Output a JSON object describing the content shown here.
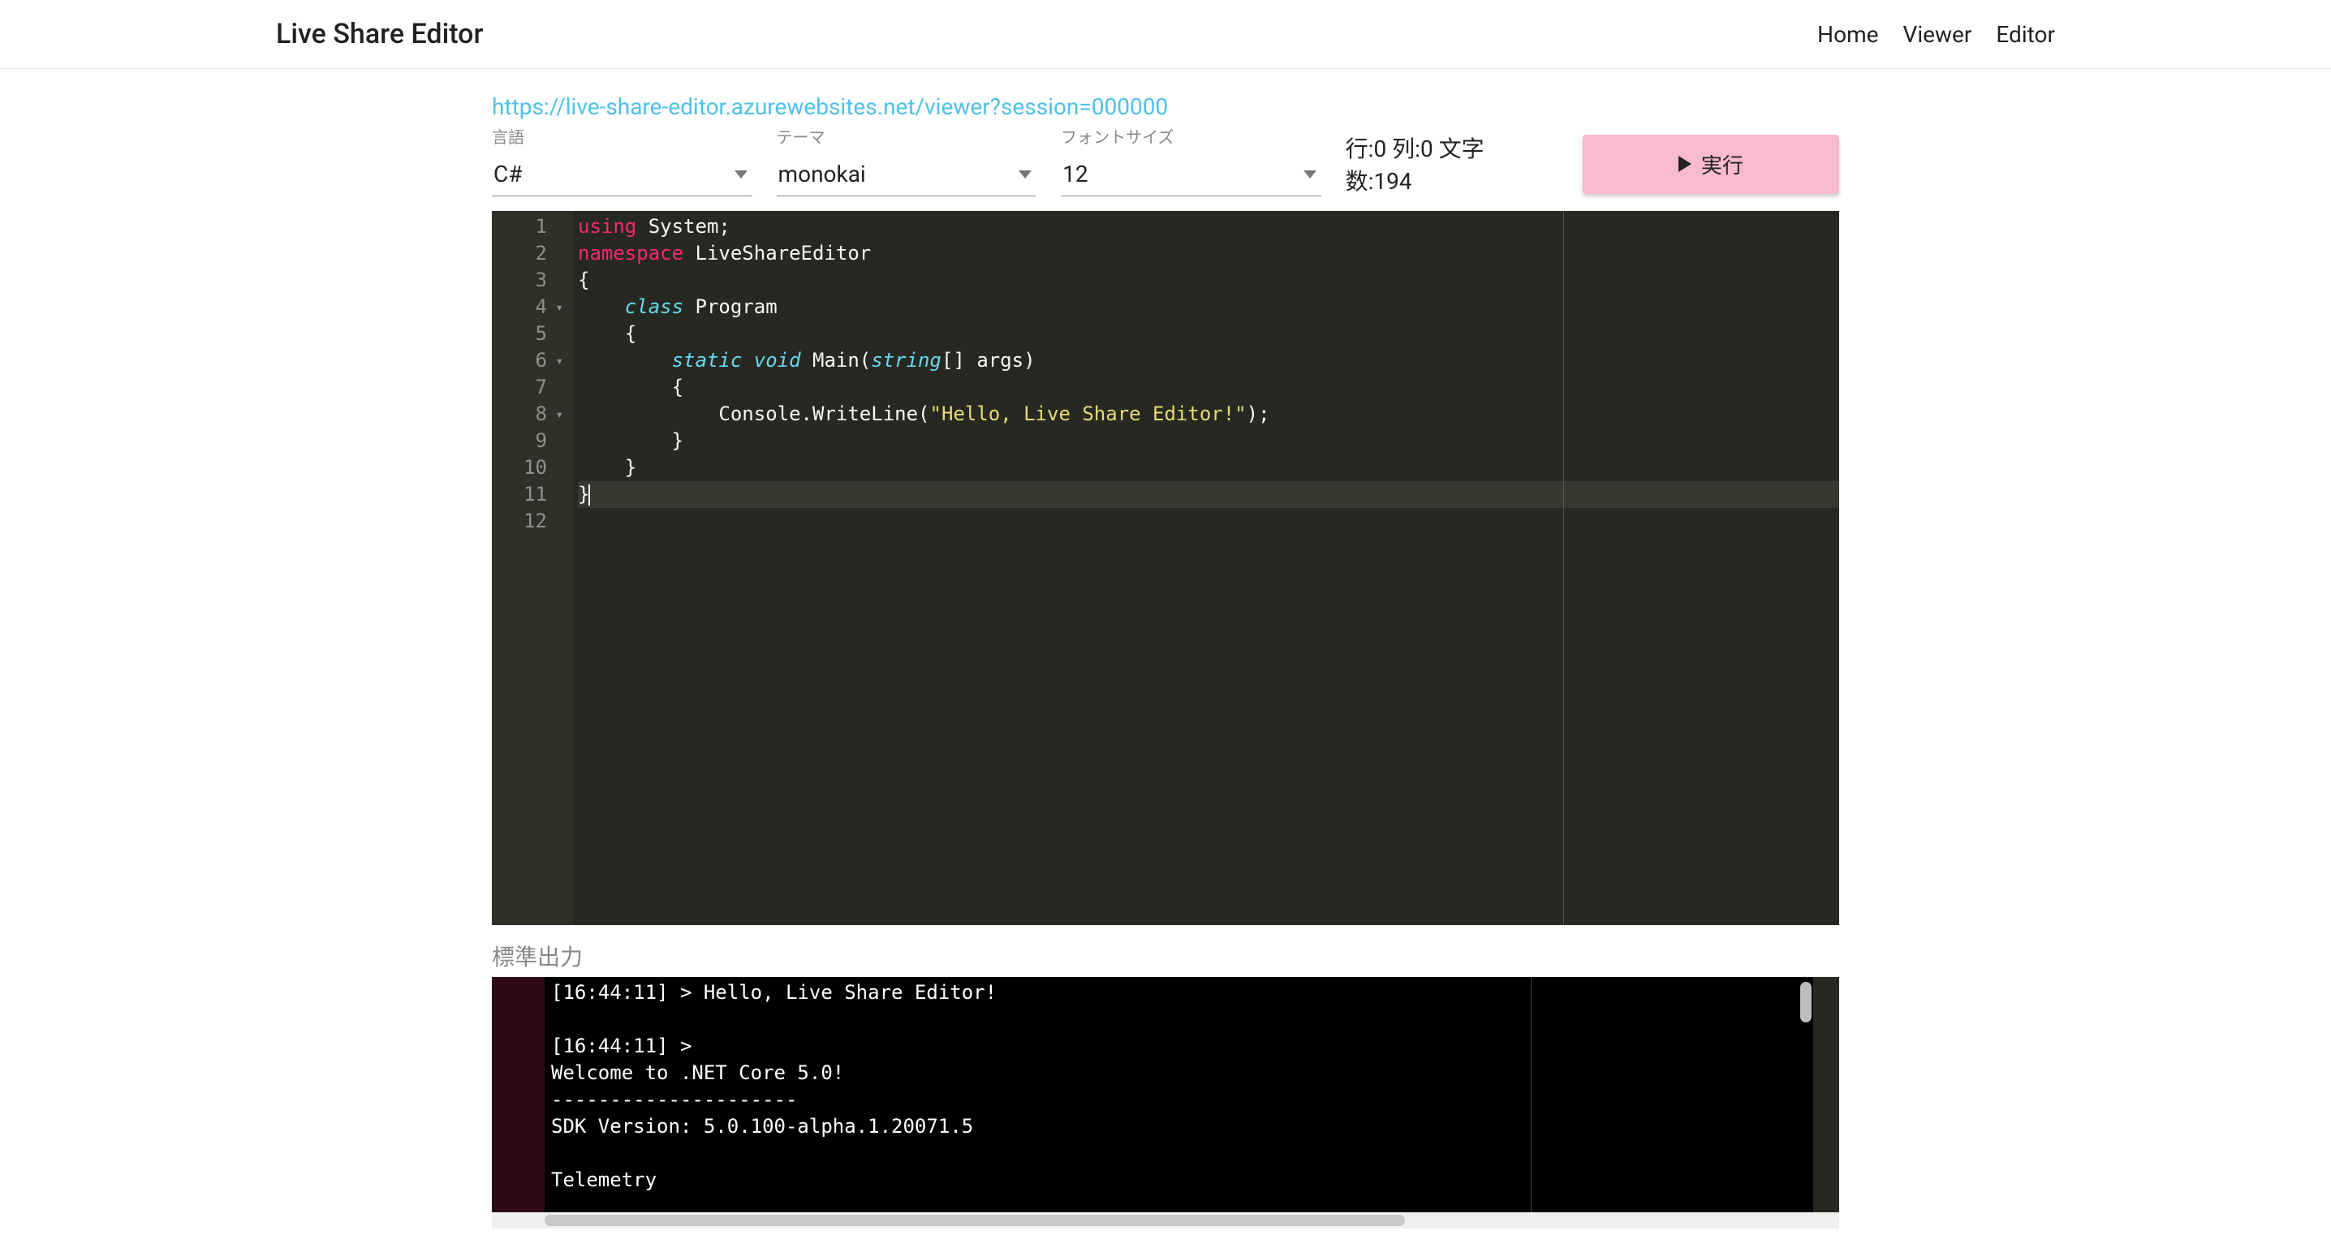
{
  "header": {
    "brand": "Live Share Editor",
    "nav": {
      "home": "Home",
      "viewer": "Viewer",
      "editor": "Editor"
    }
  },
  "share_url": "https://live-share-editor.azurewebsites.net/viewer?session=000000",
  "selects": {
    "language": {
      "label": "言語",
      "value": "C#"
    },
    "theme": {
      "label": "テーマ",
      "value": "monokai"
    },
    "fontsize": {
      "label": "フォントサイズ",
      "value": "12"
    }
  },
  "status": {
    "line_label": "行:",
    "line": "0",
    "col_label": "列:",
    "col": "0",
    "chars_label": "文字数:",
    "chars": "194"
  },
  "run_label": "実行",
  "code": {
    "tokens": [
      [
        {
          "t": "using",
          "c": "kw-pink"
        },
        {
          "t": " ",
          "c": "punct"
        },
        {
          "t": "System",
          "c": "ident"
        },
        {
          "t": ";",
          "c": "punct"
        }
      ],
      [],
      [
        {
          "t": "namespace",
          "c": "kw-pink"
        },
        {
          "t": " ",
          "c": "punct"
        },
        {
          "t": "LiveShareEditor",
          "c": "ident"
        }
      ],
      [
        {
          "t": "{",
          "c": "punct"
        }
      ],
      [
        {
          "t": "    ",
          "c": "punct"
        },
        {
          "t": "class",
          "c": "kw-blue"
        },
        {
          "t": " ",
          "c": "punct"
        },
        {
          "t": "Program",
          "c": "ident"
        }
      ],
      [
        {
          "t": "    {",
          "c": "punct"
        }
      ],
      [
        {
          "t": "        ",
          "c": "punct"
        },
        {
          "t": "static",
          "c": "kw-blue"
        },
        {
          "t": " ",
          "c": "punct"
        },
        {
          "t": "void",
          "c": "kw-blue"
        },
        {
          "t": " ",
          "c": "punct"
        },
        {
          "t": "Main",
          "c": "ident"
        },
        {
          "t": "(",
          "c": "punct"
        },
        {
          "t": "string",
          "c": "kw-blue"
        },
        {
          "t": "[] ",
          "c": "punct"
        },
        {
          "t": "args",
          "c": "ident"
        },
        {
          "t": ")",
          "c": "punct"
        }
      ],
      [
        {
          "t": "        {",
          "c": "punct"
        }
      ],
      [
        {
          "t": "            ",
          "c": "punct"
        },
        {
          "t": "Console",
          "c": "ident"
        },
        {
          "t": ".",
          "c": "punct"
        },
        {
          "t": "WriteLine",
          "c": "ident"
        },
        {
          "t": "(",
          "c": "punct"
        },
        {
          "t": "\"Hello, Live Share Editor!\"",
          "c": "str-yellow"
        },
        {
          "t": ");",
          "c": "punct"
        }
      ],
      [
        {
          "t": "        }",
          "c": "punct"
        }
      ],
      [
        {
          "t": "    }",
          "c": "punct"
        }
      ],
      [
        {
          "t": "}",
          "c": "punct"
        }
      ]
    ],
    "fold_lines": [
      4,
      6,
      8
    ],
    "active_line": 12
  },
  "output_label": "標準出力",
  "output_lines": [
    "[16:44:11] > Hello, Live Share Editor!",
    "",
    "[16:44:11] >",
    "Welcome to .NET Core 5.0!",
    "---------------------",
    "SDK Version: 5.0.100-alpha.1.20071.5",
    "",
    "Telemetry"
  ]
}
